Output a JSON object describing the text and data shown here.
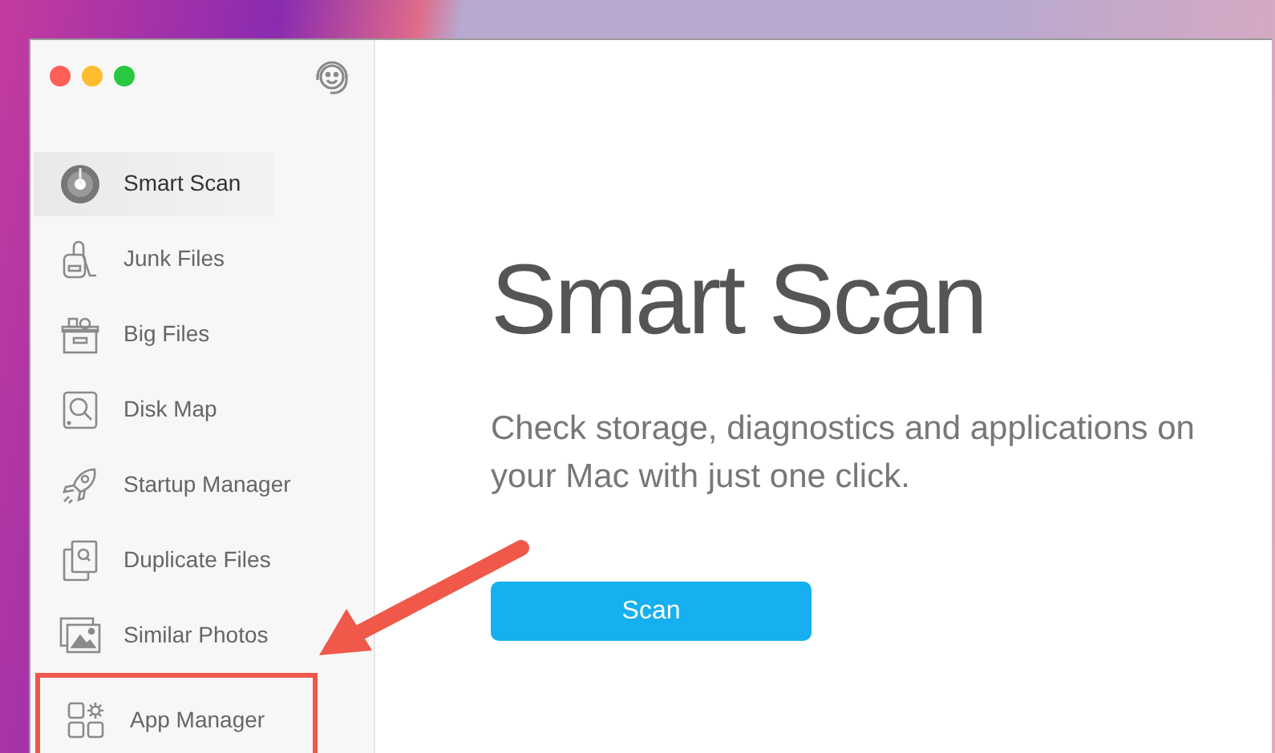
{
  "sidebar": {
    "items": [
      {
        "label": "Smart Scan",
        "selected": true,
        "highlighted": false
      },
      {
        "label": "Junk Files",
        "selected": false,
        "highlighted": false
      },
      {
        "label": "Big Files",
        "selected": false,
        "highlighted": false
      },
      {
        "label": "Disk Map",
        "selected": false,
        "highlighted": false
      },
      {
        "label": "Startup Manager",
        "selected": false,
        "highlighted": false
      },
      {
        "label": "Duplicate Files",
        "selected": false,
        "highlighted": false
      },
      {
        "label": "Similar Photos",
        "selected": false,
        "highlighted": false
      },
      {
        "label": "App Manager",
        "selected": false,
        "highlighted": true
      }
    ]
  },
  "main": {
    "title": "Smart Scan",
    "description": "Check storage, diagnostics and applications on your Mac with just one click.",
    "button": "Scan"
  }
}
